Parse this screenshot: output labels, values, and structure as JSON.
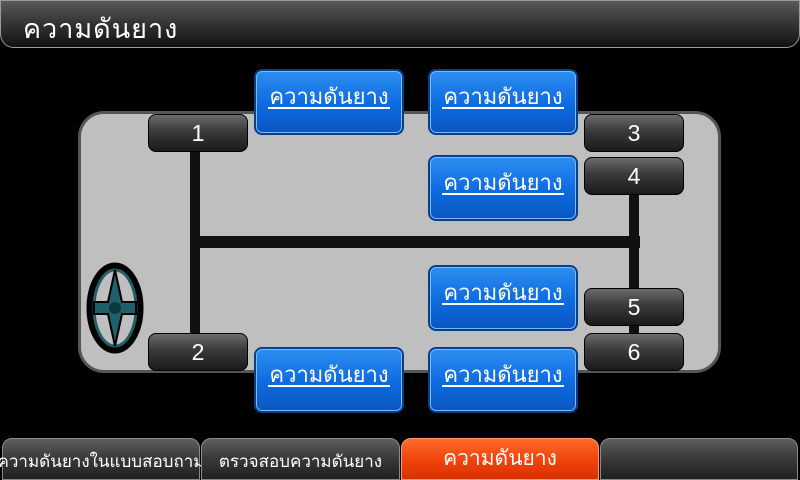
{
  "header": {
    "title": "ความดันยาง"
  },
  "colors": {
    "button_blue": "#0d6ae0",
    "active_tab": "#f0420c",
    "chassis": "#bfbfbf",
    "steering": "#1f5f6a"
  },
  "wheels": [
    {
      "id": "1",
      "label": "1"
    },
    {
      "id": "2",
      "label": "2"
    },
    {
      "id": "3",
      "label": "3"
    },
    {
      "id": "4",
      "label": "4"
    },
    {
      "id": "5",
      "label": "5"
    },
    {
      "id": "6",
      "label": "6"
    }
  ],
  "pressure_buttons": [
    {
      "label": "ความดันยาง"
    },
    {
      "label": "ความดันยาง"
    },
    {
      "label": "ความดันยาง"
    },
    {
      "label": "ความดันยาง"
    },
    {
      "label": "ความดันยาง"
    },
    {
      "label": "ความดันยาง"
    }
  ],
  "icons": {
    "steering": "steering-wheel-icon"
  },
  "tabs": [
    {
      "label": "ความดันยางในแบบสอบถาม"
    },
    {
      "label": "ตรวจสอบความดันยาง"
    },
    {
      "label": "ความดันยาง",
      "active": true
    },
    {
      "label": ""
    }
  ]
}
